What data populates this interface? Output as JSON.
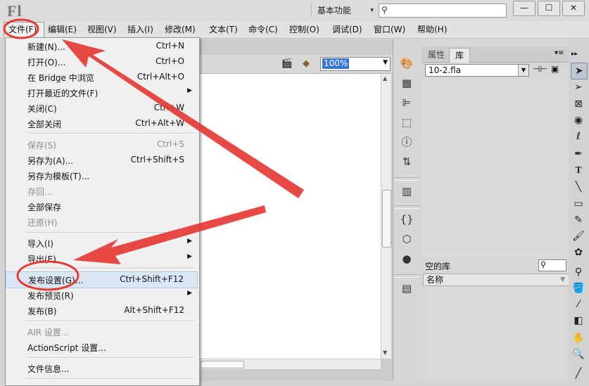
{
  "app": {
    "logo": "Fl",
    "workspace": "基本功能",
    "search_placeholder": ""
  },
  "window_controls": {
    "minimize": "—",
    "restore": "☐",
    "close": "✕"
  },
  "menubar": [
    {
      "label": "文件(F)"
    },
    {
      "label": "编辑(E)"
    },
    {
      "label": "视图(V)"
    },
    {
      "label": "插入(I)"
    },
    {
      "label": "修改(M)"
    },
    {
      "label": "文本(T)"
    },
    {
      "label": "命令(C)"
    },
    {
      "label": "控制(O)"
    },
    {
      "label": "调试(D)"
    },
    {
      "label": "窗口(W)"
    },
    {
      "label": "帮助(H)"
    }
  ],
  "file_menu": [
    {
      "label": "新建(N)...",
      "accel": "Ctrl+N"
    },
    {
      "label": "打开(O)...",
      "accel": "Ctrl+O"
    },
    {
      "label": "在 Bridge 中浏览",
      "accel": "Ctrl+Alt+O"
    },
    {
      "label": "打开最近的文件(F)",
      "accel": ""
    },
    {
      "label": "关闭(C)",
      "accel": "Ctrl+W"
    },
    {
      "label": "全部关闭",
      "accel": "Ctrl+Alt+W"
    },
    {
      "label": "保存(S)",
      "accel": "Ctrl+S"
    },
    {
      "label": "另存为(A)...",
      "accel": "Ctrl+Shift+S"
    },
    {
      "label": "另存为模板(T)...",
      "accel": ""
    },
    {
      "label": "存回...",
      "accel": ""
    },
    {
      "label": "全部保存",
      "accel": ""
    },
    {
      "label": "还原(H)",
      "accel": ""
    },
    {
      "label": "导入(I)",
      "accel": ""
    },
    {
      "label": "导出(E)",
      "accel": ""
    },
    {
      "label": "发布设置(G)...",
      "accel": "Ctrl+Shift+F12"
    },
    {
      "label": "发布预览(R)",
      "accel": ""
    },
    {
      "label": "发布(B)",
      "accel": "Alt+Shift+F12"
    },
    {
      "label": "AIR 设置...",
      "accel": ""
    },
    {
      "label": "ActionScript 设置...",
      "accel": ""
    },
    {
      "label": "文件信息...",
      "accel": ""
    }
  ],
  "document": {
    "zoom": "100%"
  },
  "library": {
    "tab_properties": "属性",
    "tab_library": "库",
    "selected_file": "10-2.fla",
    "empty_label": "空的库",
    "column_name": "名称"
  },
  "colors": {
    "accent_highlight": "#3875d7",
    "annotation_red": "#e53935"
  }
}
